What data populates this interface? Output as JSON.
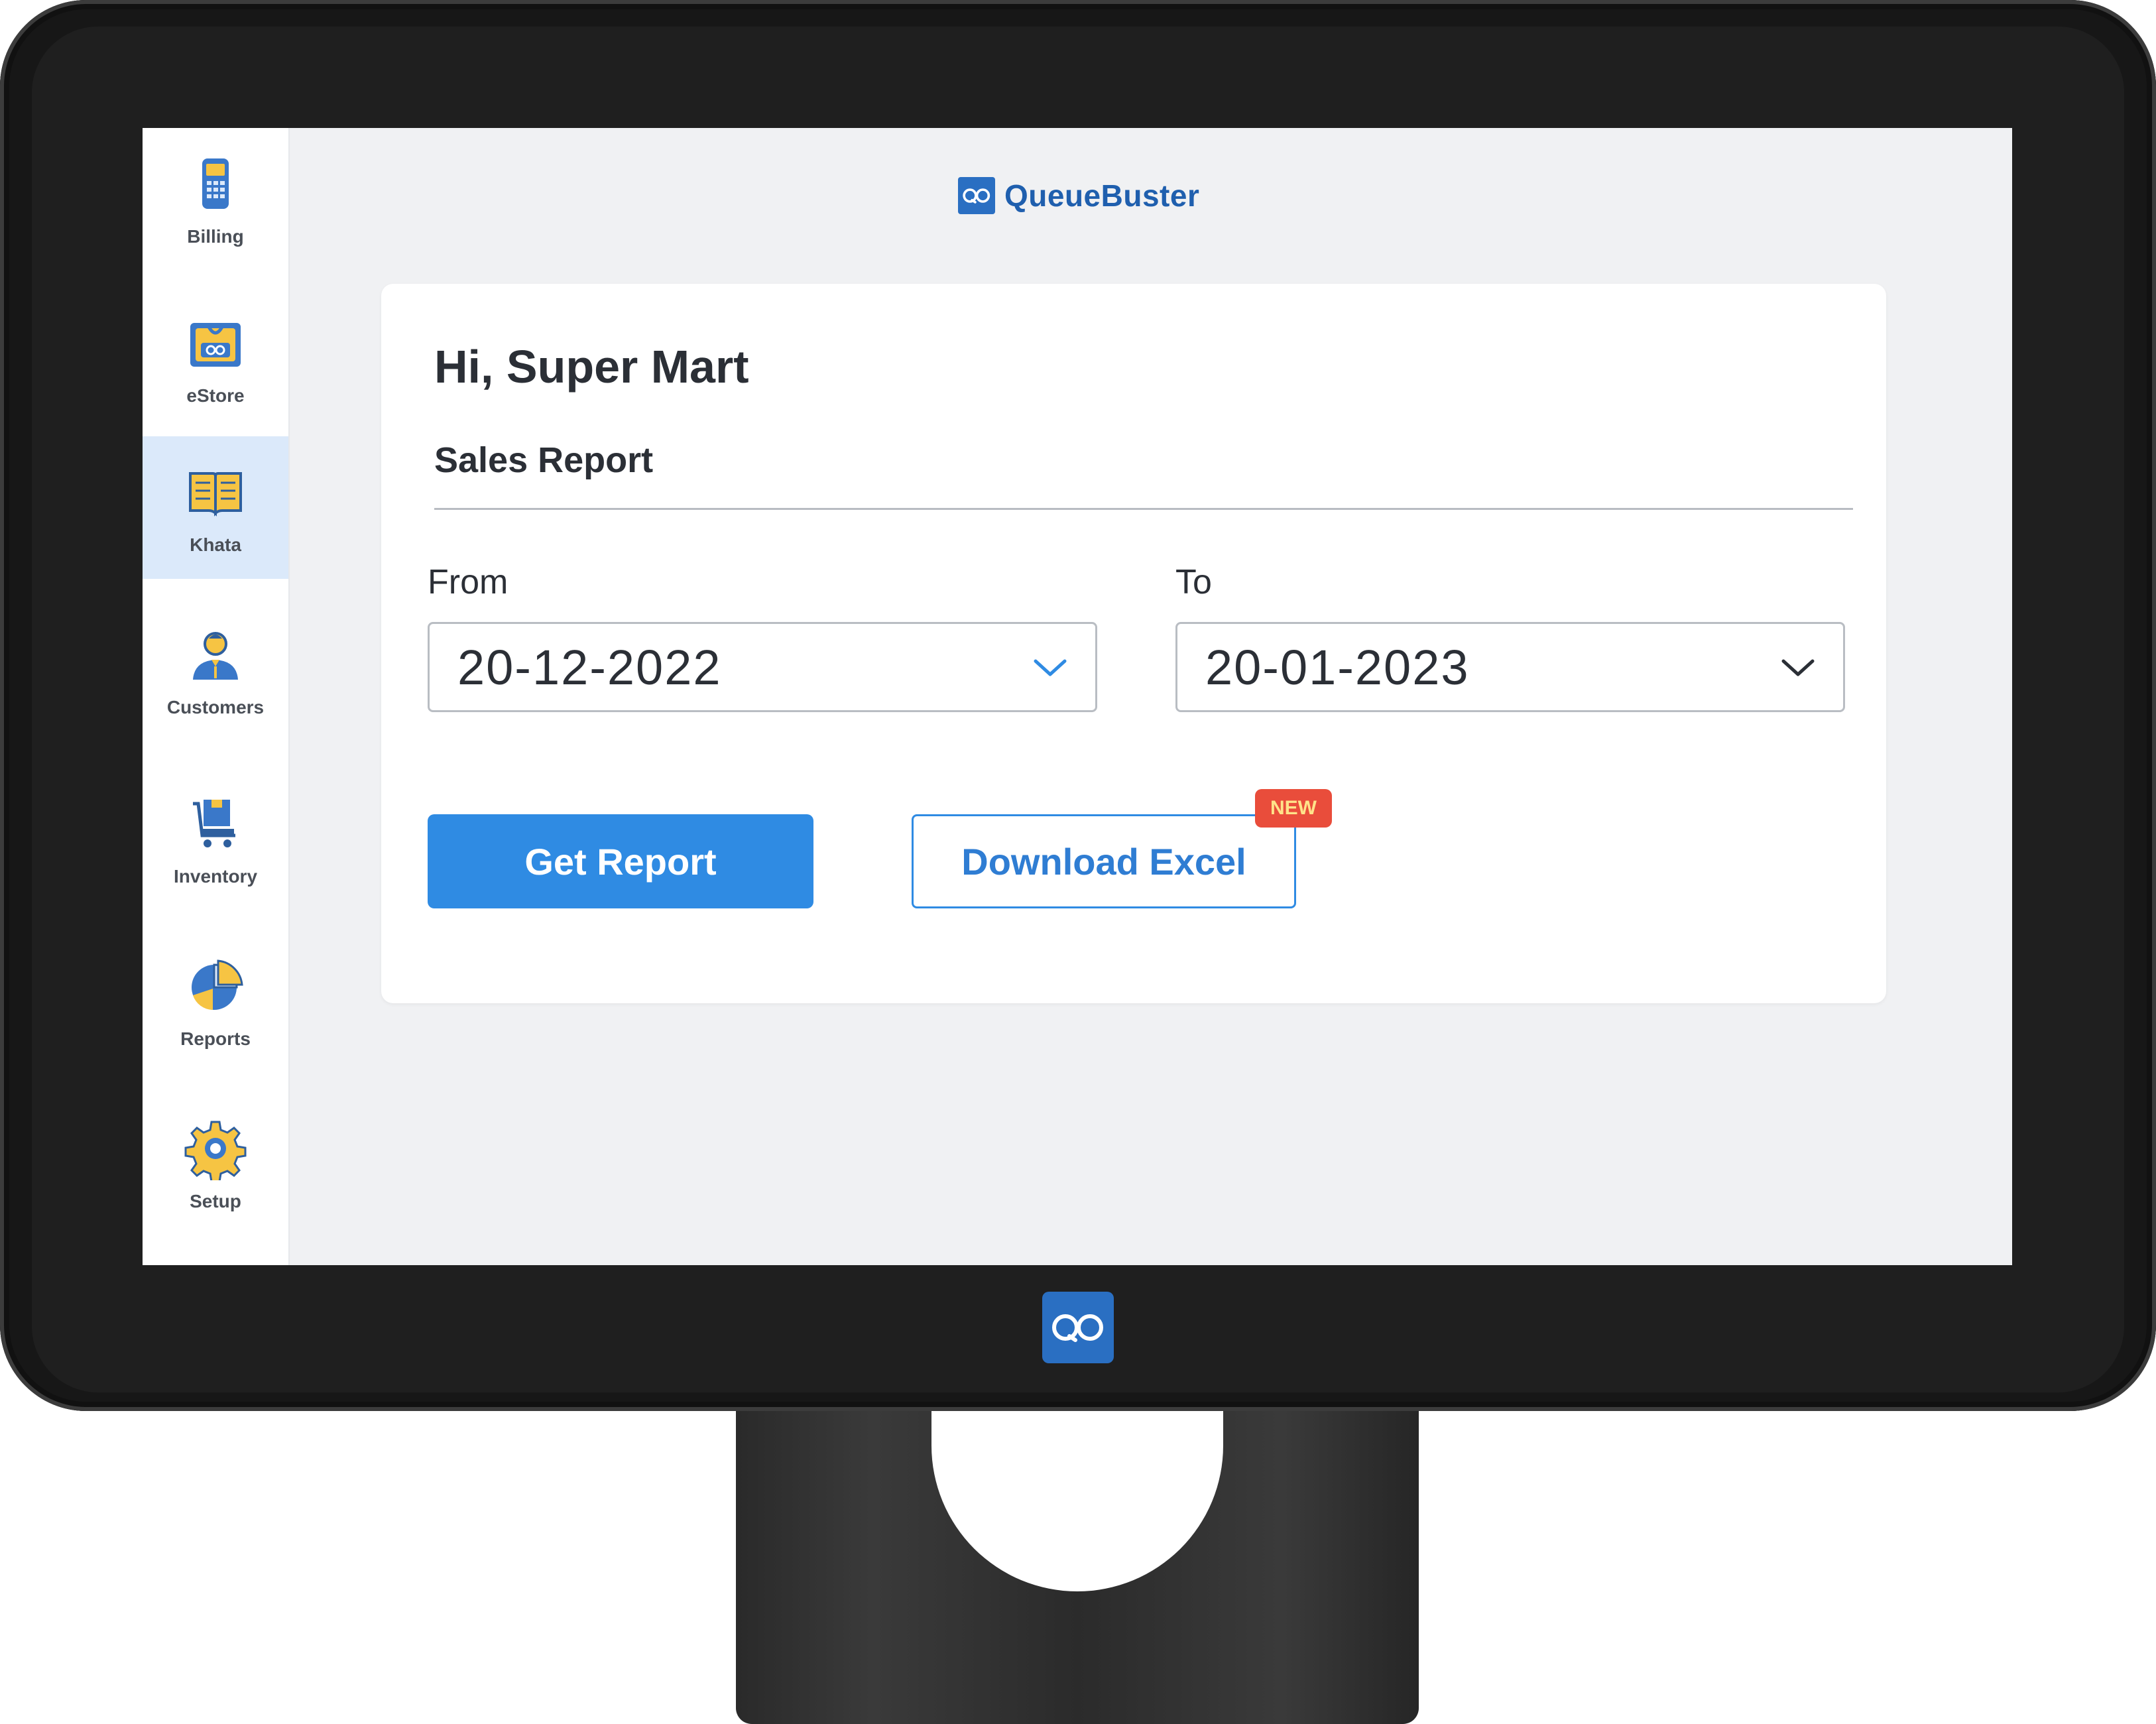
{
  "app": {
    "brand_name": "QueueBuster",
    "accent_color": "#2f8be3",
    "brand_color": "#2a6fc2",
    "badge_color": "#e94d3b"
  },
  "sidebar": {
    "items": [
      {
        "label": "Billing",
        "icon": "billing-terminal-icon",
        "active": false
      },
      {
        "label": "eStore",
        "icon": "estore-bag-icon",
        "active": false
      },
      {
        "label": "Khata",
        "icon": "khata-book-icon",
        "active": true
      },
      {
        "label": "Customers",
        "icon": "customer-person-icon",
        "active": false
      },
      {
        "label": "Inventory",
        "icon": "inventory-cart-icon",
        "active": false
      },
      {
        "label": "Reports",
        "icon": "reports-pie-chart-icon",
        "active": false
      },
      {
        "label": "Setup",
        "icon": "setup-gear-icon",
        "active": false
      }
    ]
  },
  "card": {
    "greeting": "Hi, Super Mart",
    "section_title": "Sales Report",
    "from": {
      "label": "From",
      "value": "20-12-2022"
    },
    "to": {
      "label": "To",
      "value": "20-01-2023"
    },
    "get_report_label": "Get Report",
    "download_excel_label": "Download Excel",
    "badge_label": "NEW"
  }
}
